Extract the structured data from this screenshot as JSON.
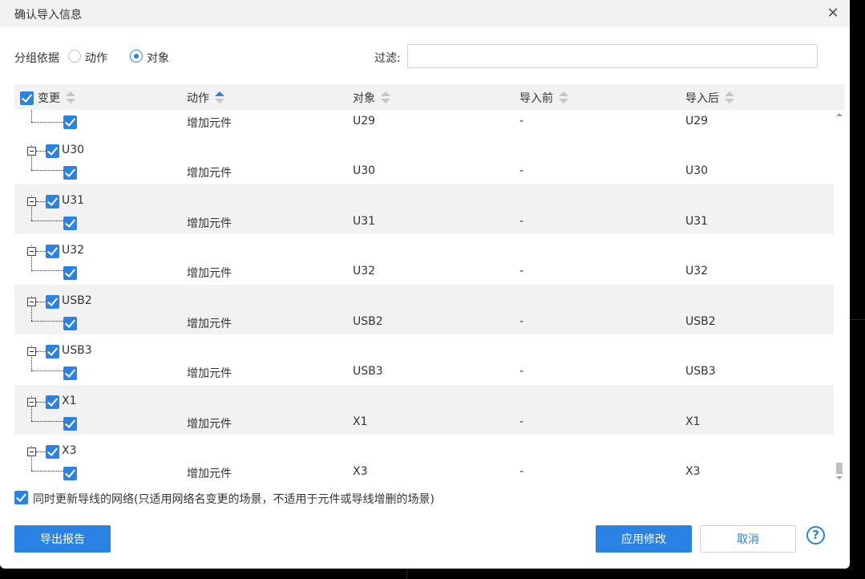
{
  "dialog": {
    "title": "确认导入信息",
    "close_icon": "close-icon"
  },
  "filterbar": {
    "group_label": "分组依据",
    "options": [
      {
        "label": "动作",
        "selected": false
      },
      {
        "label": "对象",
        "selected": true
      }
    ],
    "filter_label": "过滤:",
    "filter_value": "",
    "filter_placeholder": ""
  },
  "table": {
    "columns": [
      {
        "label": "变更",
        "sort": "none"
      },
      {
        "label": "动作",
        "sort": "asc"
      },
      {
        "label": "对象",
        "sort": "none"
      },
      {
        "label": "导入前",
        "sort": "none"
      },
      {
        "label": "导入后",
        "sort": "none"
      }
    ],
    "first_child": {
      "action": "增加元件",
      "object": "U29",
      "before": "-",
      "after": "U29"
    },
    "groups": [
      {
        "name": "U30",
        "action": "增加元件",
        "object": "U30",
        "before": "-",
        "after": "U30"
      },
      {
        "name": "U31",
        "action": "增加元件",
        "object": "U31",
        "before": "-",
        "after": "U31"
      },
      {
        "name": "U32",
        "action": "增加元件",
        "object": "U32",
        "before": "-",
        "after": "U32"
      },
      {
        "name": "USB2",
        "action": "增加元件",
        "object": "USB2",
        "before": "-",
        "after": "USB2"
      },
      {
        "name": "USB3",
        "action": "增加元件",
        "object": "USB3",
        "before": "-",
        "after": "USB3"
      },
      {
        "name": "X1",
        "action": "增加元件",
        "object": "X1",
        "before": "-",
        "after": "X1"
      },
      {
        "name": "X3",
        "action": "增加元件",
        "object": "X3",
        "before": "-",
        "after": "X3"
      }
    ]
  },
  "options": {
    "sync_nets_checked": true,
    "sync_nets_label": "同时更新导线的网络(只适用网络名变更的场景，不适用于元件或导线增删的场景)"
  },
  "footer": {
    "export_label": "导出报告",
    "apply_label": "应用修改",
    "cancel_label": "取消",
    "help_label": "?"
  },
  "colors": {
    "accent": "#2a82e4",
    "header_bg": "#f2f2f2",
    "stripe_bg": "#f2f2f2"
  }
}
